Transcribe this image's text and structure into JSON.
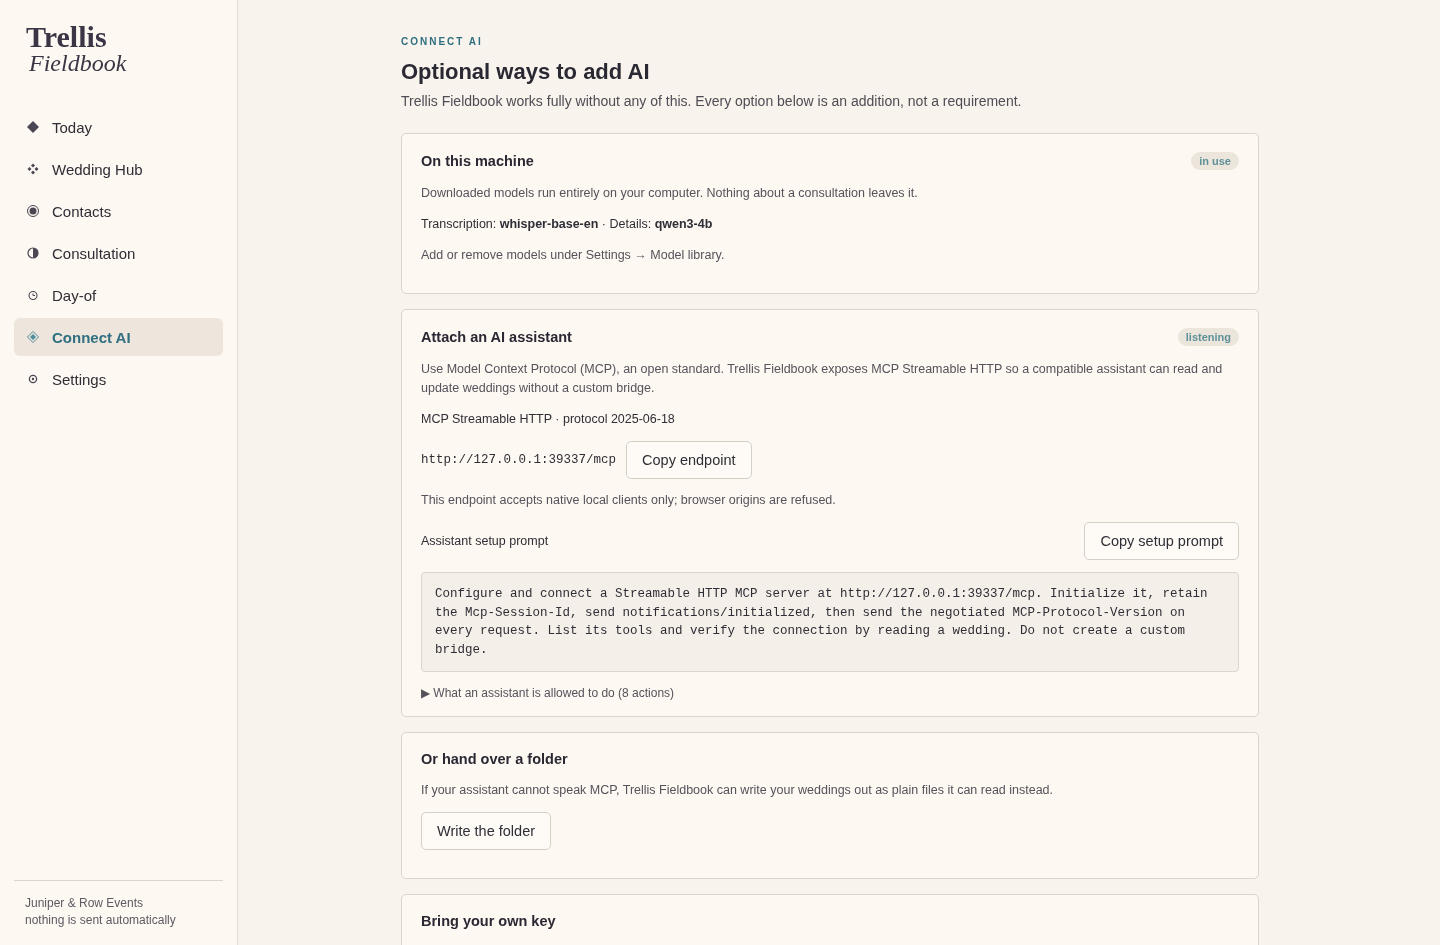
{
  "sidebar": {
    "logo": {
      "line1": "Trellis",
      "line2": "Fieldbook"
    },
    "items": [
      {
        "label": "Today",
        "selected": false
      },
      {
        "label": "Wedding Hub",
        "selected": false
      },
      {
        "label": "Contacts",
        "selected": false
      },
      {
        "label": "Consultation",
        "selected": false
      },
      {
        "label": "Day-of",
        "selected": false
      },
      {
        "label": "Connect AI",
        "selected": true
      },
      {
        "label": "Settings",
        "selected": false
      }
    ],
    "footer": {
      "studio": "Juniper & Row Events",
      "note": "nothing is sent automatically"
    }
  },
  "header": {
    "eyebrow": "CONNECT AI",
    "title": "Optional ways to add AI",
    "subtitle": "Trellis Fieldbook works fully without any of this. Every option below is an addition, not a requirement."
  },
  "cards": [
    {
      "title": "On this machine",
      "badge": "in use",
      "blocks": [
        {
          "kind": "text",
          "text": "Downloaded models run entirely on your computer. Nothing about a consultation leaves it."
        },
        {
          "kind": "strong",
          "text": "Transcription: **whisper-base-en** · Details: **qwen3-4b**"
        },
        {
          "kind": "text",
          "text": "Add or remove models under Settings → Model library."
        }
      ]
    },
    {
      "title": "Attach an AI assistant",
      "badge": "listening",
      "blocks": [
        {
          "kind": "text",
          "text": "Use Model Context Protocol (MCP), an open standard. Trellis Fieldbook exposes MCP Streamable HTTP so a compatible assistant can read and update weddings without a custom bridge."
        },
        {
          "kind": "strong",
          "text": "MCP Streamable HTTP · protocol 2025-06-18"
        },
        {
          "kind": "endpoint",
          "text": "http://127.0.0.1:39337/mcp",
          "button": "Copy endpoint"
        },
        {
          "kind": "text",
          "text": "This endpoint accepts native local clients only; browser origins are refused."
        },
        {
          "kind": "labelled",
          "text": "Assistant setup prompt",
          "button": "Copy setup prompt"
        },
        {
          "kind": "prompt",
          "text": "Configure and connect a Streamable HTTP MCP server at http://127.0.0.1:39337/mcp. Initialize it, retain the Mcp-Session-Id, send notifications/initialized, then send the negotiated MCP-Protocol-Version on every request. List its tools and verify the connection by reading a wedding. Do not create a custom bridge."
        },
        {
          "kind": "disclosure",
          "marker": "▶",
          "text": "What an assistant is allowed to do (8 actions)"
        }
      ]
    },
    {
      "title": "Or hand over a folder",
      "blocks": [
        {
          "kind": "text",
          "text": "If your assistant cannot speak MCP, Trellis Fieldbook can write your weddings out as plain files it can read instead."
        },
        {
          "kind": "button",
          "button": "Write the folder"
        }
      ]
    },
    {
      "title": "Bring your own key"
    }
  ]
}
